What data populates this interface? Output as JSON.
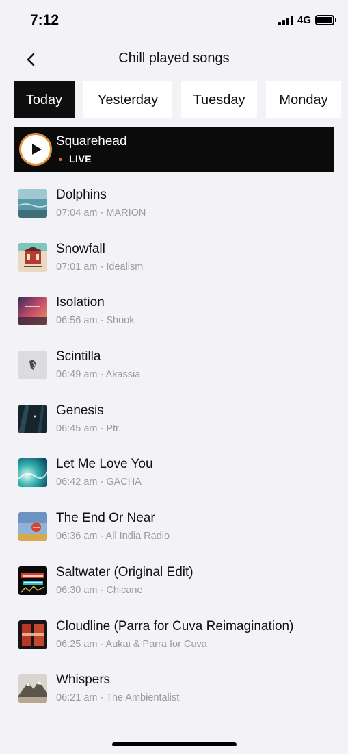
{
  "status_bar": {
    "time": "7:12",
    "network": "4G"
  },
  "header": {
    "title": "Chill played songs"
  },
  "day_tabs": [
    {
      "label": "Today",
      "active": true
    },
    {
      "label": "Yesterday",
      "active": false
    },
    {
      "label": "Tuesday",
      "active": false
    },
    {
      "label": "Monday",
      "active": false
    }
  ],
  "live": {
    "title": "Squarehead",
    "status": "LIVE",
    "accent_color": "#e0903a",
    "dot_color": "#e8613a"
  },
  "songs": [
    {
      "title": "Dolphins",
      "meta": "07:04 am - MARION",
      "art": "ocean-art"
    },
    {
      "title": "Snowfall",
      "meta": "07:01 am - Idealism",
      "art": "temple-art"
    },
    {
      "title": "Isolation",
      "meta": "06:56 am - Shook",
      "art": "sunset-art"
    },
    {
      "title": "Scintilla",
      "meta": "06:49 am - Akassia",
      "art": "leaf-logo-art"
    },
    {
      "title": "Genesis",
      "meta": "06:45 am - Ptr.",
      "art": "dark-forest-art"
    },
    {
      "title": "Let Me Love You",
      "meta": "06:42 am - GACHA",
      "art": "teal-wave-art"
    },
    {
      "title": "The End Or Near",
      "meta": "06:36 am - All India Radio",
      "art": "desert-art"
    },
    {
      "title": "Saltwater (Original Edit)",
      "meta": "06:30 am - Chicane",
      "art": "trance-art"
    },
    {
      "title": "Cloudline (Parra for Cuva Reimagination)",
      "meta": "06:25 am - Aukai & Parra for Cuva",
      "art": "red-sky-art"
    },
    {
      "title": "Whispers",
      "meta": "06:21 am - The Ambientalist",
      "art": "mountain-art"
    }
  ],
  "colors": {
    "background": "#f2f2f7",
    "active_tab": "#0e0e0e",
    "meta_text": "#9a9aa0"
  }
}
